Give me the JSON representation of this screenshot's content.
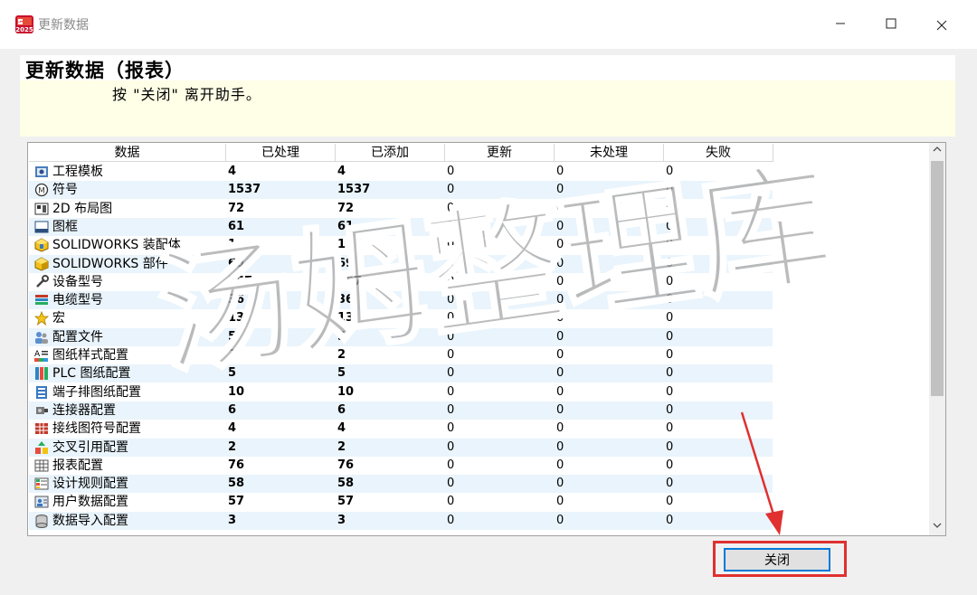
{
  "window": {
    "title": "更新数据",
    "app_icon_label": "2025"
  },
  "header": {
    "title": "更新数据（报表）",
    "subtitle": "按 \"关闭\" 离开助手。"
  },
  "table": {
    "columns": [
      "数据",
      "已处理",
      "已添加",
      "更新",
      "未处理",
      "失败"
    ],
    "rows": [
      {
        "icon": "project-template-icon",
        "name": "工程模板",
        "processed": "4",
        "added": "4",
        "updated": "0",
        "unprocessed": "0",
        "failed": "0"
      },
      {
        "icon": "symbol-icon",
        "name": "符号",
        "processed": "1537",
        "added": "1537",
        "updated": "0",
        "unprocessed": "0",
        "failed": "0"
      },
      {
        "icon": "layout-2d-icon",
        "name": "2D 布局图",
        "processed": "72",
        "added": "72",
        "updated": "0",
        "unprocessed": "0",
        "failed": "0"
      },
      {
        "icon": "title-block-icon",
        "name": "图框",
        "processed": "61",
        "added": "61",
        "updated": "0",
        "unprocessed": "0",
        "failed": "0"
      },
      {
        "icon": "assembly-icon",
        "name": "SOLIDWORKS 装配体",
        "processed": "1",
        "added": "1",
        "updated": "0",
        "unprocessed": "0",
        "failed": "0"
      },
      {
        "icon": "part-icon",
        "name": "SOLIDWORKS 部件",
        "processed": "69",
        "added": "69",
        "updated": "0",
        "unprocessed": "0",
        "failed": "0"
      },
      {
        "icon": "wrench-icon",
        "name": "设备型号",
        "processed": "357",
        "added": "357",
        "updated": "0",
        "unprocessed": "0",
        "failed": "0"
      },
      {
        "icon": "cable-icon",
        "name": "电缆型号",
        "processed": "36",
        "added": "36",
        "updated": "0",
        "unprocessed": "0",
        "failed": "0"
      },
      {
        "icon": "star-icon",
        "name": "宏",
        "processed": "13",
        "added": "13",
        "updated": "0",
        "unprocessed": "0",
        "failed": "0"
      },
      {
        "icon": "users-icon",
        "name": "配置文件",
        "processed": "5",
        "added": "5",
        "updated": "0",
        "unprocessed": "0",
        "failed": "0"
      },
      {
        "icon": "drawing-style-icon",
        "name": "图纸样式配置",
        "processed": "2",
        "added": "2",
        "updated": "0",
        "unprocessed": "0",
        "failed": "0"
      },
      {
        "icon": "plc-icon",
        "name": "PLC 图纸配置",
        "processed": "5",
        "added": "5",
        "updated": "0",
        "unprocessed": "0",
        "failed": "0"
      },
      {
        "icon": "terminal-strip-icon",
        "name": "端子排图纸配置",
        "processed": "10",
        "added": "10",
        "updated": "0",
        "unprocessed": "0",
        "failed": "0"
      },
      {
        "icon": "connector-icon",
        "name": "连接器配置",
        "processed": "6",
        "added": "6",
        "updated": "0",
        "unprocessed": "0",
        "failed": "0"
      },
      {
        "icon": "wiring-symbol-icon",
        "name": "接线图符号配置",
        "processed": "4",
        "added": "4",
        "updated": "0",
        "unprocessed": "0",
        "failed": "0"
      },
      {
        "icon": "cross-reference-icon",
        "name": "交叉引用配置",
        "processed": "2",
        "added": "2",
        "updated": "0",
        "unprocessed": "0",
        "failed": "0"
      },
      {
        "icon": "report-table-icon",
        "name": "报表配置",
        "processed": "76",
        "added": "76",
        "updated": "0",
        "unprocessed": "0",
        "failed": "0"
      },
      {
        "icon": "design-rule-icon",
        "name": "设计规则配置",
        "processed": "58",
        "added": "58",
        "updated": "0",
        "unprocessed": "0",
        "failed": "0"
      },
      {
        "icon": "user-data-icon",
        "name": "用户数据配置",
        "processed": "57",
        "added": "57",
        "updated": "0",
        "unprocessed": "0",
        "failed": "0"
      },
      {
        "icon": "database-import-icon",
        "name": "数据导入配置",
        "processed": "3",
        "added": "3",
        "updated": "0",
        "unprocessed": "0",
        "failed": "0"
      }
    ]
  },
  "footer": {
    "close_label": "关闭"
  },
  "watermark": {
    "text": "汤姆整理库"
  },
  "colors": {
    "highlight": "#e03030",
    "focus": "#0078d7",
    "row_alt": "#e9f4fc",
    "header_bg": "#fffee6"
  }
}
